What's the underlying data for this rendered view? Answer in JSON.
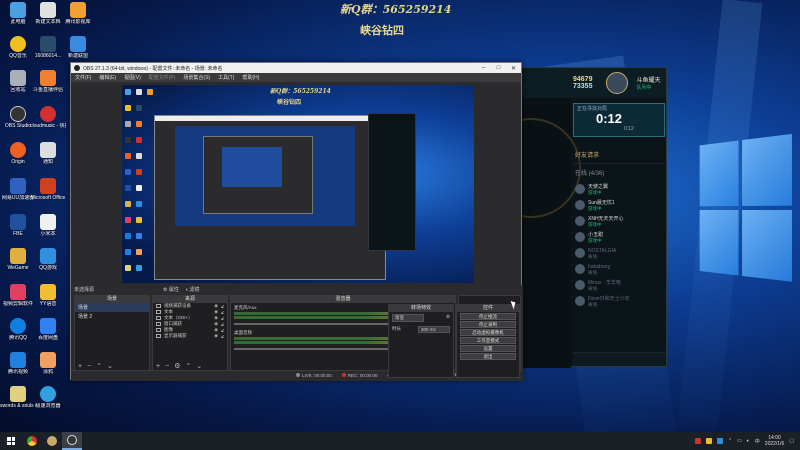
{
  "overlay": {
    "group_label": "新Q群：565259214",
    "server_label": "峡谷钻四"
  },
  "desktop_icons": [
    {
      "label": "此电脑",
      "color": "#4aa0e0"
    },
    {
      "label": "新建文本档",
      "color": "#e0e0e0"
    },
    {
      "label": "腾讯影视库",
      "color": "#f0a030"
    },
    {
      "label": "QQ音乐",
      "color": "#f0c020"
    },
    {
      "label": "16086014...",
      "color": "#2a4a6a"
    },
    {
      "label": "新建联盟",
      "color": "#3a8ae0"
    },
    {
      "label": "回收站",
      "color": "#aab0b8"
    },
    {
      "label": "斗鱼直播伴侣",
      "color": "#f08030"
    },
    {
      "label": "OBS Studio",
      "color": "#333333"
    },
    {
      "label": "cloudmusic - 快捷方式",
      "color": "#d03030"
    },
    {
      "label": "Origin",
      "color": "#f06020"
    },
    {
      "label": "通知",
      "color": "#dddddd"
    },
    {
      "label": "网易UU加速器",
      "color": "#3060c0"
    },
    {
      "label": "Microsoft Office",
      "color": "#d04020"
    },
    {
      "label": "FBE",
      "color": "#2050a0"
    },
    {
      "label": "小米本",
      "color": "#f0f0f0"
    },
    {
      "label": "WeGame",
      "color": "#e0b040"
    },
    {
      "label": "QQ游戏",
      "color": "#3090e0"
    },
    {
      "label": "视频剪辑软件",
      "color": "#e04060"
    },
    {
      "label": "YY语音",
      "color": "#f0c030"
    },
    {
      "label": "腾讯QQ",
      "color": "#1080e0"
    },
    {
      "label": "百度网盘",
      "color": "#3080f0"
    },
    {
      "label": "腾讯视频",
      "color": "#2080e0"
    },
    {
      "label": "涂鸦",
      "color": "#f0a060"
    },
    {
      "label": "swords & souls ne...",
      "color": "#e0d080"
    },
    {
      "label": "极速浏览器",
      "color": "#30a0e0"
    }
  ],
  "obs": {
    "title": "OBS 27.1.3 (64-bit, windows) - 配置文件: 未命名 - 场景: 未命名",
    "menu": [
      "文件(F)",
      "编辑(E)",
      "视图(V)",
      "配置文件(P)",
      "场景集合(S)",
      "工具(T)",
      "帮助(H)"
    ],
    "preview": {
      "group_label": "新Q群：565259214",
      "server_label": "峡谷钻四"
    },
    "no_source_label": "未选择源",
    "props_button": "属性",
    "filters_button": "滤镜",
    "scenes": {
      "header": "场景",
      "items": [
        "场景",
        "场景 2"
      ]
    },
    "sources": {
      "header": "来源",
      "items": [
        "视频捕获设备",
        "文本",
        "文本（GDI+）",
        "窗口捕获",
        "图像",
        "显示器捕获"
      ]
    },
    "mixer": {
      "header": "混音器",
      "tracks": [
        {
          "name": "麦克风/Aux",
          "db": "0.0 dB"
        },
        {
          "name": "桌面音频",
          "db": "-5.4 dB"
        }
      ]
    },
    "transitions": {
      "header": "转场特效",
      "type": "渐变",
      "duration_label": "时长",
      "duration_value": "300 ms"
    },
    "controls": {
      "header": "控件",
      "buttons": [
        "停止推流",
        "停止录制",
        "启动虚拟摄像机",
        "工作室模式",
        "设置",
        "退出"
      ]
    },
    "status": {
      "live_label": "LIVE:",
      "live_time": "00:00:00",
      "rec_label": "REC:",
      "rec_time": "00:00:00",
      "cpu": "CPU: 0.7%, 30.00 fps",
      "extra": "延迟（10 秒后开始）"
    }
  },
  "game": {
    "currency_gold": "94679",
    "currency_blue": "73355",
    "player_name": "斗鱼耀天",
    "player_status": "队列中",
    "queue_title": "正在寻找对局",
    "queue_time": "0:12",
    "queue_sub": "0:12",
    "friends_header": "好友请求",
    "friends_count": "在线 (4/36)",
    "friends": [
      {
        "name": "天使之翼",
        "status": "游戏中",
        "online": true
      },
      {
        "name": "Sun晨无忧1",
        "status": "游戏中",
        "online": true
      },
      {
        "name": "XNH无天天开心",
        "status": "游戏中",
        "online": true
      },
      {
        "name": "小玉甜",
        "status": "游戏中",
        "online": true
      },
      {
        "name": "NOSTALGIA",
        "status": "离线",
        "online": false
      },
      {
        "name": "bababang",
        "status": "离线",
        "online": false
      },
      {
        "name": "Minas · 羊羊喵",
        "status": "离线",
        "online": false
      },
      {
        "name": "Dove日和天士少年",
        "status": "离线",
        "online": false
      }
    ]
  },
  "taskbar": {
    "time": "14:00",
    "date": "2022/1/6"
  }
}
